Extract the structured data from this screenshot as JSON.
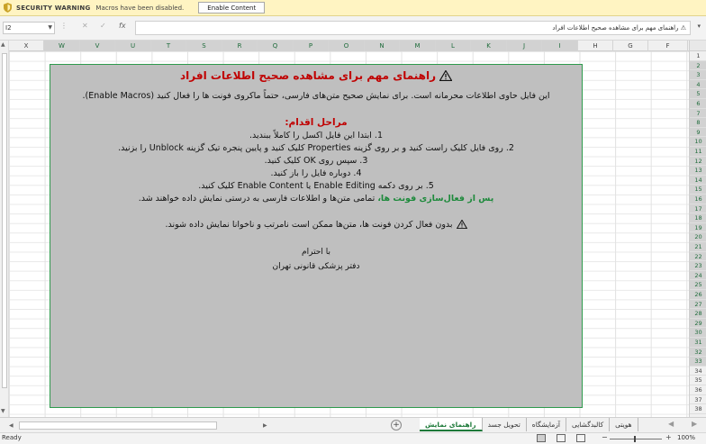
{
  "security_bar": {
    "title": "SECURITY WARNING",
    "message": "Macros have been disabled.",
    "button": "Enable Content"
  },
  "formula_bar": {
    "name_box": "I2",
    "formula": "راهنمای مهم برای مشاهده صحیح اطلاعات افراد"
  },
  "columns": [
    "X",
    "W",
    "V",
    "U",
    "T",
    "S",
    "R",
    "Q",
    "P",
    "O",
    "N",
    "M",
    "L",
    "K",
    "J",
    "I",
    "H",
    "G",
    "F"
  ],
  "rows": [
    "1",
    "2",
    "3",
    "4",
    "5",
    "6",
    "7",
    "8",
    "9",
    "10",
    "11",
    "12",
    "13",
    "14",
    "15",
    "16",
    "17",
    "18",
    "19",
    "20",
    "21",
    "22",
    "23",
    "24",
    "25",
    "26",
    "27",
    "28",
    "29",
    "30",
    "31",
    "32",
    "33",
    "34",
    "35",
    "36",
    "37",
    "38"
  ],
  "message_box": {
    "title": "راهنمای مهم برای مشاهده صحیح اطلاعات افراد",
    "intro": "این فایل حاوی اطلاعات محرمانه است. برای نمایش صحیح متن‌های فارسی، حتماً ماکروی فونت ها را فعال کنید (Enable Macros).",
    "steps_heading": "مراحل اقدام:",
    "steps": [
      "1. ابتدا این فایل اکسل را کاملاً ببندید.",
      "2. روی فایل کلیک راست کنید و بر روی گزینه Properties کلیک کنید و پایین پنجره تیک گزینه Unblock را بزنید.",
      "3. سپس روی OK کلیک کنید.",
      "4. دوباره فایل را باز کنید.",
      "5. بر روی دکمه Enable Editing یا Enable Content کلیک کنید."
    ],
    "after_green": "پس از فعال‌سازی فونت ها،",
    "after_rest": " تمامی متن‌ها و اطلاعات فارسی به درستی نمایش داده خواهند شد.",
    "note": "بدون فعال کردن فونت ها، متن‌ها ممکن است نامرتب و ناخوانا نمایش داده شوند.",
    "sign_1": "با احترام",
    "sign_2": "دفتر پزشکی قانونی تهران"
  },
  "sheet_tabs": [
    "هویتی",
    "کالبدگشایی",
    "آزمایشگاه",
    "تحویل جسد",
    "راهنمای نمایش"
  ],
  "active_tab_index": 4,
  "status": {
    "ready": "Ready",
    "zoom": "100%"
  },
  "colors": {
    "warning_red": "#c00000",
    "green_accent": "#1e8a3c",
    "box_gray": "#bfbfbf",
    "security_yellow": "#fff4c2"
  }
}
